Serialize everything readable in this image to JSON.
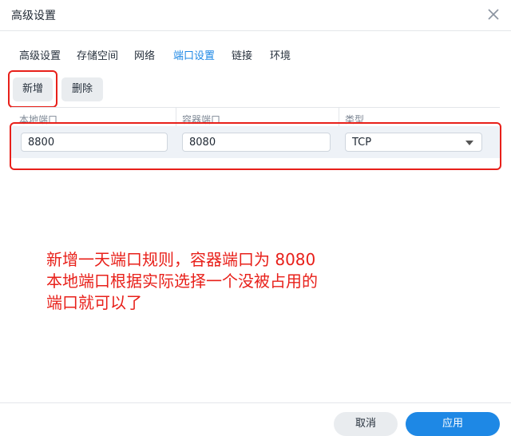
{
  "dialog": {
    "title": "高级设置"
  },
  "tabs": [
    {
      "label": "高级设置"
    },
    {
      "label": "存储空间"
    },
    {
      "label": "网络"
    },
    {
      "label": "端口设置",
      "active": true
    },
    {
      "label": "链接"
    },
    {
      "label": "环境"
    }
  ],
  "toolbar": {
    "add_label": "新增",
    "delete_label": "删除"
  },
  "table": {
    "columns": [
      "本地端口",
      "容器端口",
      "类型"
    ],
    "rows": [
      {
        "local_port": "8800",
        "container_port": "8080",
        "type": "TCP"
      }
    ]
  },
  "annotation": {
    "lines": [
      "新增一天端口规则，容器端口为 8080",
      "本地端口根据实际选择一个没被占用的",
      "端口就可以了"
    ]
  },
  "footer": {
    "cancel_label": "取消",
    "apply_label": "应用"
  },
  "colors": {
    "accent": "#1e88e5",
    "annotation": "#e8201a"
  }
}
